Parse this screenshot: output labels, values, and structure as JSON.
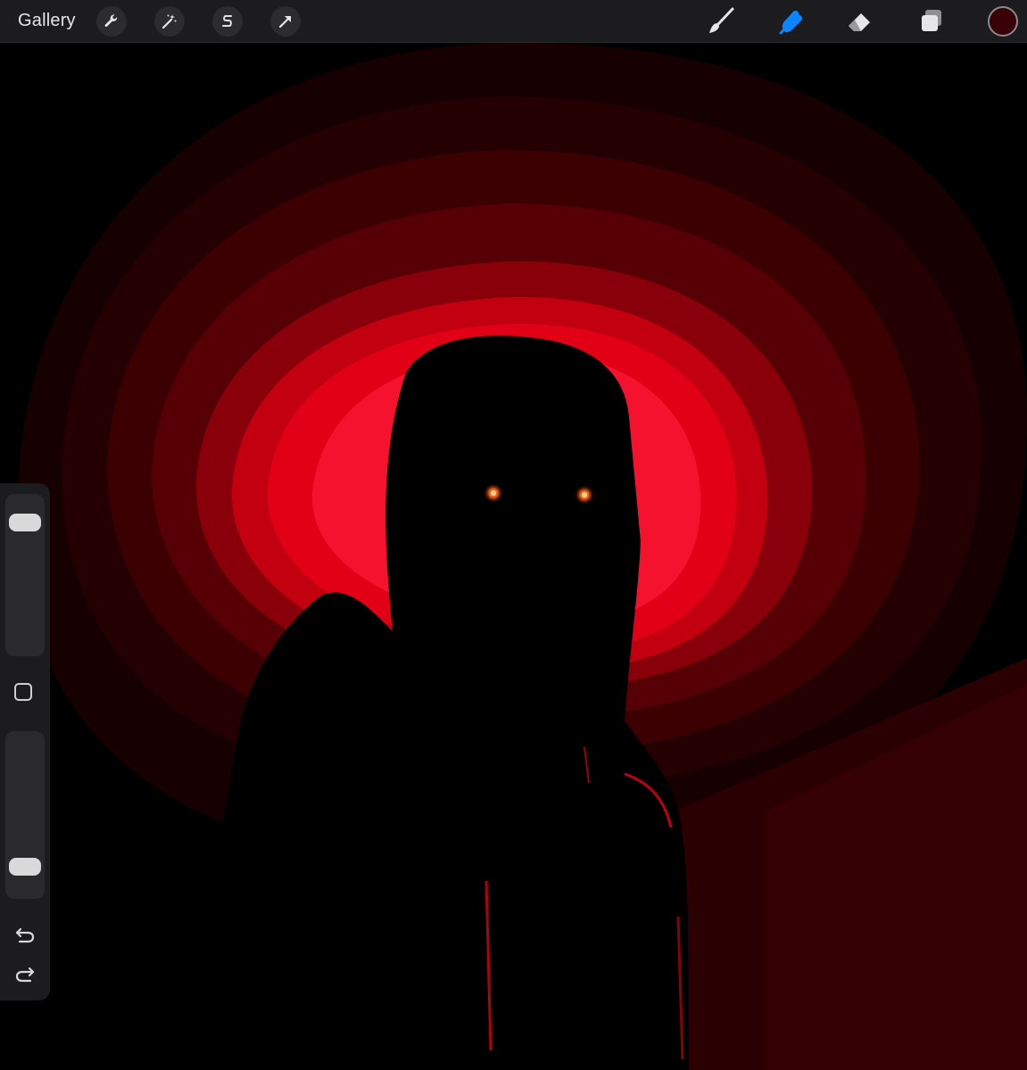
{
  "topbar": {
    "gallery_label": "Gallery",
    "left_tools": [
      "wrench-icon",
      "magic-wand-icon",
      "selection-s-icon",
      "transform-arrow-icon"
    ],
    "right_tools": [
      "brush-icon",
      "smudge-icon",
      "eraser-icon",
      "layers-icon"
    ],
    "active_tool": "smudge-icon",
    "active_color": "#3a0008",
    "accent_color": "#0a84ff"
  },
  "sidebar": {
    "brush_size_icon": "slider-thumb",
    "modify_icon": "square-icon",
    "opacity_icon": "slider-thumb",
    "undo_icon": "undo-icon",
    "redo_icon": "redo-icon"
  },
  "canvas": {
    "background": "#000000",
    "glow_colors": [
      "#1a0002",
      "#2a0003",
      "#400004",
      "#5a0006",
      "#8a000b",
      "#c0000f",
      "#e30016",
      "#f5132f"
    ],
    "eye_color": "#e05a10"
  }
}
